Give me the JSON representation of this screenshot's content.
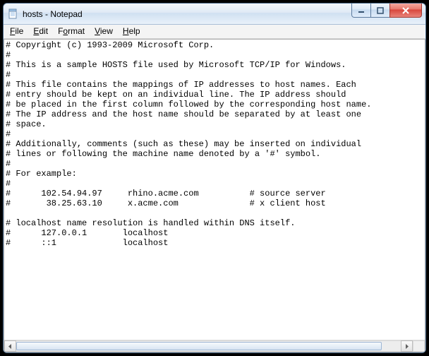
{
  "window": {
    "title": "hosts - Notepad"
  },
  "menu": {
    "file": "File",
    "edit": "Edit",
    "format": "Format",
    "view": "View",
    "help": "Help"
  },
  "content": "# Copyright (c) 1993-2009 Microsoft Corp.\n#\n# This is a sample HOSTS file used by Microsoft TCP/IP for Windows.\n#\n# This file contains the mappings of IP addresses to host names. Each\n# entry should be kept on an individual line. The IP address should\n# be placed in the first column followed by the corresponding host name.\n# The IP address and the host name should be separated by at least one\n# space.\n#\n# Additionally, comments (such as these) may be inserted on individual\n# lines or following the machine name denoted by a '#' symbol.\n#\n# For example:\n#\n#      102.54.94.97     rhino.acme.com          # source server\n#       38.25.63.10     x.acme.com              # x client host\n\n# localhost name resolution is handled within DNS itself.\n#      127.0.0.1       localhost\n#      ::1             localhost"
}
